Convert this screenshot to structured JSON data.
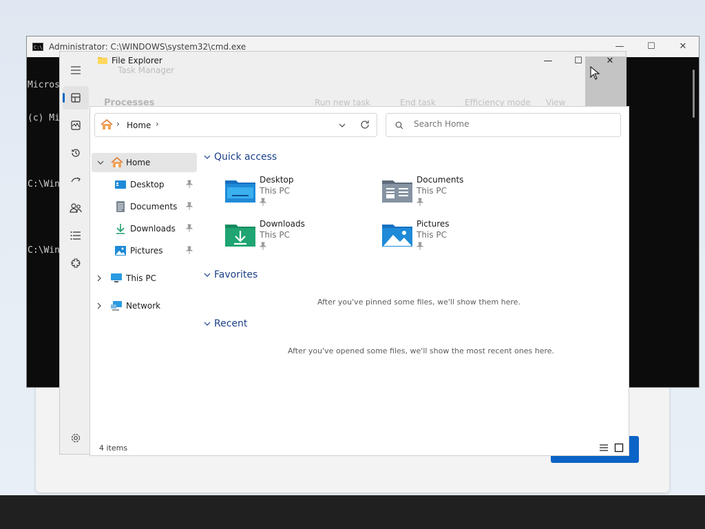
{
  "cmd": {
    "title": "Administrator: C:\\WINDOWS\\system32\\cmd.exe",
    "icon_text": "C:\\",
    "lines": [
      "Micros",
      "(c) Mi",
      "",
      "C:\\Win",
      "",
      "C:\\Win"
    ],
    "controls": {
      "minimize": "—",
      "maximize": "☐",
      "close": "✕"
    }
  },
  "task_manager": {
    "title": "Task Manager",
    "heading": "Processes",
    "run_new_task": "Run new task",
    "end_task": "End task",
    "efficiency_mode": "Efficiency mode",
    "view": "View",
    "sidebar_icons": [
      "hamburger-menu-icon",
      "processes-icon",
      "performance-icon",
      "app-history-icon",
      "startup-apps-icon",
      "users-icon",
      "details-icon",
      "services-icon",
      "settings-icon"
    ]
  },
  "explorer": {
    "title": "File Explorer",
    "controls": {
      "minimize": "—",
      "maximize": "☐",
      "close": "✕"
    },
    "address": {
      "location": "Home",
      "separator": "›"
    },
    "search_placeholder": "Search Home",
    "nav": {
      "home": "Home",
      "pinned": [
        {
          "label": "Desktop",
          "icon": "desktop-folder-icon"
        },
        {
          "label": "Documents",
          "icon": "documents-folder-icon"
        },
        {
          "label": "Downloads",
          "icon": "downloads-folder-icon"
        },
        {
          "label": "Pictures",
          "icon": "pictures-folder-icon"
        }
      ],
      "this_pc": "This PC",
      "network": "Network"
    },
    "sections": {
      "quick_access": "Quick access",
      "favorites": "Favorites",
      "favorites_empty": "After you've pinned some files, we'll show them here.",
      "recent": "Recent",
      "recent_empty": "After you've opened some files, we'll show the most recent ones here."
    },
    "quick_access_items": [
      {
        "name": "Desktop",
        "location": "This PC"
      },
      {
        "name": "Documents",
        "location": "This PC"
      },
      {
        "name": "Downloads",
        "location": "This PC"
      },
      {
        "name": "Pictures",
        "location": "This PC"
      }
    ],
    "status": "4 items"
  },
  "colors": {
    "accent": "#0067c0",
    "section_heading": "#1a3f87",
    "folder_blue": "#1e8ad8",
    "folder_green": "#20a472"
  }
}
